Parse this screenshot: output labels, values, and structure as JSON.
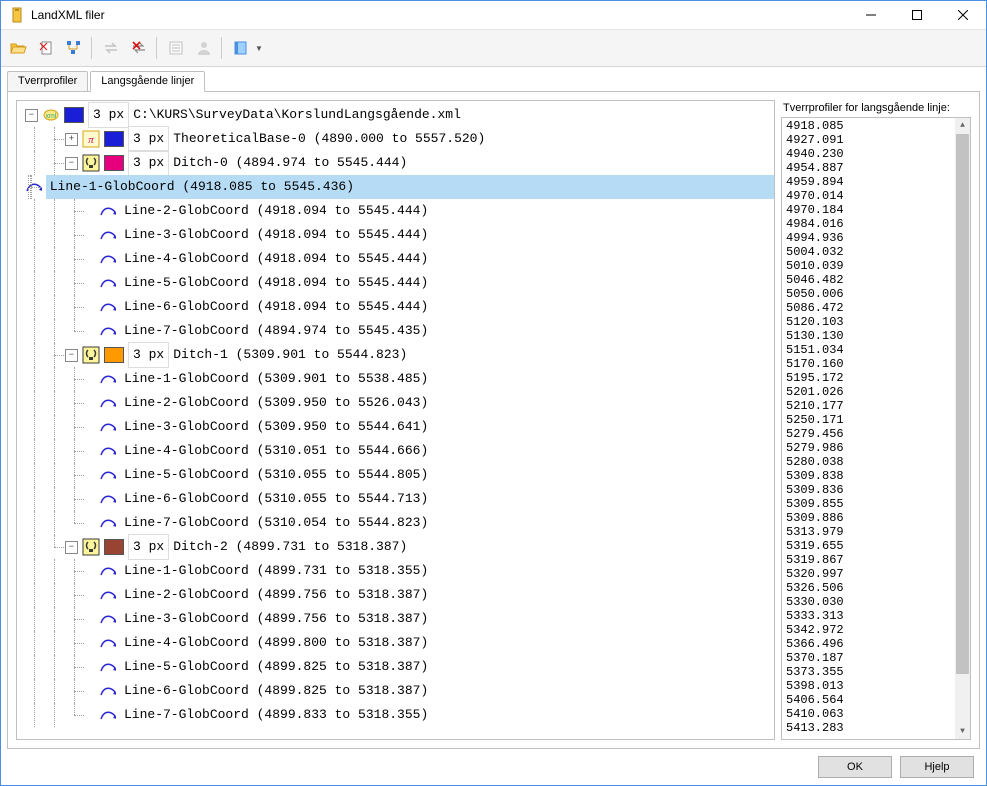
{
  "window": {
    "title": "LandXML filer"
  },
  "toolbar": {
    "items": [
      "open-folder",
      "delete-doc",
      "tool-3",
      "swap",
      "delete-node",
      "list-tool",
      "user-tool",
      "book-tool"
    ]
  },
  "tabs": [
    {
      "label": "Tverrprofiler",
      "active": false
    },
    {
      "label": "Langsgående linjer",
      "active": true
    }
  ],
  "side": {
    "label": "Tverrprofiler for langsgående linje:",
    "values": [
      "4918.085",
      "4927.091",
      "4940.230",
      "4954.887",
      "4959.894",
      "4970.014",
      "4970.184",
      "4984.016",
      "4994.936",
      "5004.032",
      "5010.039",
      "5046.482",
      "5050.006",
      "5086.472",
      "5120.103",
      "5130.130",
      "5151.034",
      "5170.160",
      "5195.172",
      "5201.026",
      "5210.177",
      "5250.171",
      "5279.456",
      "5279.986",
      "5280.038",
      "5309.838",
      "5309.836",
      "5309.855",
      "5309.886",
      "5313.979",
      "5319.655",
      "5319.867",
      "5320.997",
      "5326.506",
      "5330.030",
      "5333.313",
      "5342.972",
      "5366.496",
      "5370.187",
      "5373.355",
      "5398.013",
      "5406.564",
      "5410.063",
      "5413.283"
    ]
  },
  "buttons": {
    "ok": "OK",
    "help": "Hjelp"
  },
  "tree": {
    "root": {
      "px": "3 px",
      "color": "#1a1ed6",
      "path": "C:\\KURS\\SurveyData\\KorslundLangsgående.xml"
    },
    "groups": [
      {
        "exp": "plus",
        "icon": "pi",
        "color": "#1a1ed6",
        "px": "3 px",
        "label": "TheoreticalBase-0 (4890.000 to 5557.520)",
        "lines": []
      },
      {
        "exp": "minus",
        "icon": "bulb",
        "color": "#e6007e",
        "px": "3 px",
        "label": "Ditch-0 (4894.974 to 5545.444)",
        "lines": [
          {
            "label": "Line-1-GlobCoord (4918.085 to 5545.436)",
            "selected": true
          },
          {
            "label": "Line-2-GlobCoord (4918.094 to 5545.444)"
          },
          {
            "label": "Line-3-GlobCoord (4918.094 to 5545.444)"
          },
          {
            "label": "Line-4-GlobCoord (4918.094 to 5545.444)"
          },
          {
            "label": "Line-5-GlobCoord (4918.094 to 5545.444)"
          },
          {
            "label": "Line-6-GlobCoord (4918.094 to 5545.444)"
          },
          {
            "label": "Line-7-GlobCoord (4894.974 to 5545.435)"
          }
        ]
      },
      {
        "exp": "minus",
        "icon": "bulb",
        "color": "#ff9900",
        "px": "3 px",
        "label": "Ditch-1 (5309.901 to 5544.823)",
        "lines": [
          {
            "label": "Line-1-GlobCoord (5309.901 to 5538.485)"
          },
          {
            "label": "Line-2-GlobCoord (5309.950 to 5526.043)"
          },
          {
            "label": "Line-3-GlobCoord (5309.950 to 5544.641)"
          },
          {
            "label": "Line-4-GlobCoord (5310.051 to 5544.666)"
          },
          {
            "label": "Line-5-GlobCoord (5310.055 to 5544.805)"
          },
          {
            "label": "Line-6-GlobCoord (5310.055 to 5544.713)"
          },
          {
            "label": "Line-7-GlobCoord (5310.054 to 5544.823)"
          }
        ]
      },
      {
        "exp": "minus",
        "icon": "bulb",
        "color": "#994433",
        "px": "3 px",
        "label": "Ditch-2 (4899.731 to 5318.387)",
        "lines": [
          {
            "label": "Line-1-GlobCoord (4899.731 to 5318.355)"
          },
          {
            "label": "Line-2-GlobCoord (4899.756 to 5318.387)"
          },
          {
            "label": "Line-3-GlobCoord (4899.756 to 5318.387)"
          },
          {
            "label": "Line-4-GlobCoord (4899.800 to 5318.387)"
          },
          {
            "label": "Line-5-GlobCoord (4899.825 to 5318.387)"
          },
          {
            "label": "Line-6-GlobCoord (4899.825 to 5318.387)"
          },
          {
            "label": "Line-7-GlobCoord (4899.833 to 5318.355)"
          }
        ]
      }
    ]
  }
}
